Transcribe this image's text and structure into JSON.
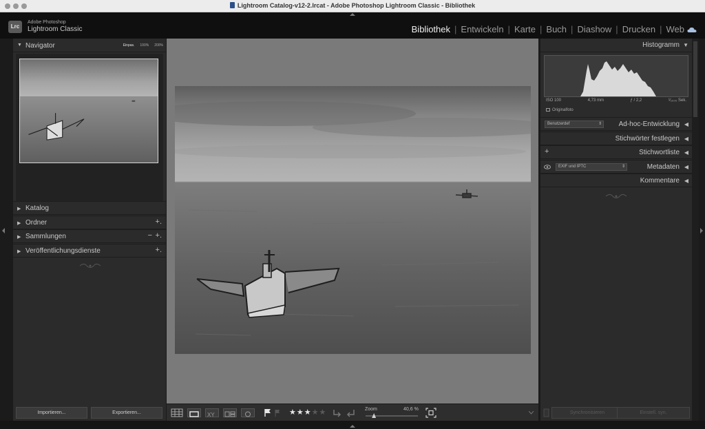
{
  "window": {
    "title": "Lightroom Catalog-v12-2.lrcat - Adobe Photoshop Lightroom Classic - Bibliothek"
  },
  "brand": {
    "logo": "Lrc",
    "line1": "Adobe Photoshop",
    "line2": "Lightroom Classic"
  },
  "modules": [
    "Bibliothek",
    "Entwickeln",
    "Karte",
    "Buch",
    "Diashow",
    "Drucken",
    "Web"
  ],
  "active_module": "Bibliothek",
  "left": {
    "navigator": {
      "label": "Navigator",
      "options": [
        "Einpas.",
        "100%",
        "200%"
      ]
    },
    "sections": [
      {
        "label": "Katalog",
        "plus": "",
        "minus": ""
      },
      {
        "label": "Ordner",
        "plus": "+.",
        "minus": ""
      },
      {
        "label": "Sammlungen",
        "plus": "+.",
        "minus": "−"
      },
      {
        "label": "Veröffentlichungsdienste",
        "plus": "+.",
        "minus": ""
      }
    ],
    "import_label": "Importieren...",
    "export_label": "Exportieren..."
  },
  "toolbar": {
    "rating": 3,
    "rating_max": 5,
    "zoom_label": "Zoom",
    "zoom_value": "40,6 %",
    "zoom_fraction": 0.16
  },
  "right": {
    "histogram_label": "Histogramm",
    "exif": {
      "iso": "ISO 100",
      "focal": "4,73 mm",
      "aperture": "ƒ / 2,2",
      "shutter": "¹⁄₁₀₀₀ Sek."
    },
    "original_label": "Originalfoto",
    "quick_develop": {
      "label": "Ad-hoc-Entwicklung",
      "preset": "Benutzerdef"
    },
    "keywording_label": "Stichwörter festlegen",
    "keyword_list": {
      "label": "Stichwortliste",
      "plus": "+"
    },
    "metadata": {
      "label": "Metadaten",
      "preset": "EXIF und IPTC"
    },
    "comments_label": "Kommentare",
    "sync_label": "Synchronisieren",
    "default_label": "Einstell. syn."
  },
  "colors": {
    "panel": "#2b2b2b",
    "background": "#7a7a7a",
    "text": "#c9c9c9",
    "active": "#f0f0f0"
  }
}
